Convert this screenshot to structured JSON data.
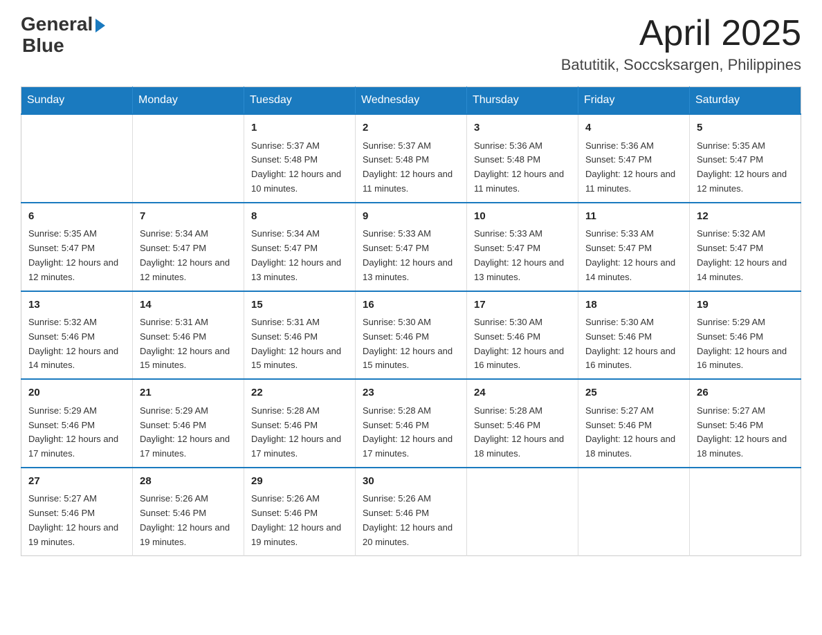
{
  "logo": {
    "text_general": "General",
    "text_blue": "Blue",
    "arrow": "▶"
  },
  "header": {
    "month_year": "April 2025",
    "location": "Batutitik, Soccsksargen, Philippines"
  },
  "weekdays": [
    "Sunday",
    "Monday",
    "Tuesday",
    "Wednesday",
    "Thursday",
    "Friday",
    "Saturday"
  ],
  "weeks": [
    [
      {
        "day": "",
        "sunrise": "",
        "sunset": "",
        "daylight": ""
      },
      {
        "day": "",
        "sunrise": "",
        "sunset": "",
        "daylight": ""
      },
      {
        "day": "1",
        "sunrise": "Sunrise: 5:37 AM",
        "sunset": "Sunset: 5:48 PM",
        "daylight": "Daylight: 12 hours and 10 minutes."
      },
      {
        "day": "2",
        "sunrise": "Sunrise: 5:37 AM",
        "sunset": "Sunset: 5:48 PM",
        "daylight": "Daylight: 12 hours and 11 minutes."
      },
      {
        "day": "3",
        "sunrise": "Sunrise: 5:36 AM",
        "sunset": "Sunset: 5:48 PM",
        "daylight": "Daylight: 12 hours and 11 minutes."
      },
      {
        "day": "4",
        "sunrise": "Sunrise: 5:36 AM",
        "sunset": "Sunset: 5:47 PM",
        "daylight": "Daylight: 12 hours and 11 minutes."
      },
      {
        "day": "5",
        "sunrise": "Sunrise: 5:35 AM",
        "sunset": "Sunset: 5:47 PM",
        "daylight": "Daylight: 12 hours and 12 minutes."
      }
    ],
    [
      {
        "day": "6",
        "sunrise": "Sunrise: 5:35 AM",
        "sunset": "Sunset: 5:47 PM",
        "daylight": "Daylight: 12 hours and 12 minutes."
      },
      {
        "day": "7",
        "sunrise": "Sunrise: 5:34 AM",
        "sunset": "Sunset: 5:47 PM",
        "daylight": "Daylight: 12 hours and 12 minutes."
      },
      {
        "day": "8",
        "sunrise": "Sunrise: 5:34 AM",
        "sunset": "Sunset: 5:47 PM",
        "daylight": "Daylight: 12 hours and 13 minutes."
      },
      {
        "day": "9",
        "sunrise": "Sunrise: 5:33 AM",
        "sunset": "Sunset: 5:47 PM",
        "daylight": "Daylight: 12 hours and 13 minutes."
      },
      {
        "day": "10",
        "sunrise": "Sunrise: 5:33 AM",
        "sunset": "Sunset: 5:47 PM",
        "daylight": "Daylight: 12 hours and 13 minutes."
      },
      {
        "day": "11",
        "sunrise": "Sunrise: 5:33 AM",
        "sunset": "Sunset: 5:47 PM",
        "daylight": "Daylight: 12 hours and 14 minutes."
      },
      {
        "day": "12",
        "sunrise": "Sunrise: 5:32 AM",
        "sunset": "Sunset: 5:47 PM",
        "daylight": "Daylight: 12 hours and 14 minutes."
      }
    ],
    [
      {
        "day": "13",
        "sunrise": "Sunrise: 5:32 AM",
        "sunset": "Sunset: 5:46 PM",
        "daylight": "Daylight: 12 hours and 14 minutes."
      },
      {
        "day": "14",
        "sunrise": "Sunrise: 5:31 AM",
        "sunset": "Sunset: 5:46 PM",
        "daylight": "Daylight: 12 hours and 15 minutes."
      },
      {
        "day": "15",
        "sunrise": "Sunrise: 5:31 AM",
        "sunset": "Sunset: 5:46 PM",
        "daylight": "Daylight: 12 hours and 15 minutes."
      },
      {
        "day": "16",
        "sunrise": "Sunrise: 5:30 AM",
        "sunset": "Sunset: 5:46 PM",
        "daylight": "Daylight: 12 hours and 15 minutes."
      },
      {
        "day": "17",
        "sunrise": "Sunrise: 5:30 AM",
        "sunset": "Sunset: 5:46 PM",
        "daylight": "Daylight: 12 hours and 16 minutes."
      },
      {
        "day": "18",
        "sunrise": "Sunrise: 5:30 AM",
        "sunset": "Sunset: 5:46 PM",
        "daylight": "Daylight: 12 hours and 16 minutes."
      },
      {
        "day": "19",
        "sunrise": "Sunrise: 5:29 AM",
        "sunset": "Sunset: 5:46 PM",
        "daylight": "Daylight: 12 hours and 16 minutes."
      }
    ],
    [
      {
        "day": "20",
        "sunrise": "Sunrise: 5:29 AM",
        "sunset": "Sunset: 5:46 PM",
        "daylight": "Daylight: 12 hours and 17 minutes."
      },
      {
        "day": "21",
        "sunrise": "Sunrise: 5:29 AM",
        "sunset": "Sunset: 5:46 PM",
        "daylight": "Daylight: 12 hours and 17 minutes."
      },
      {
        "day": "22",
        "sunrise": "Sunrise: 5:28 AM",
        "sunset": "Sunset: 5:46 PM",
        "daylight": "Daylight: 12 hours and 17 minutes."
      },
      {
        "day": "23",
        "sunrise": "Sunrise: 5:28 AM",
        "sunset": "Sunset: 5:46 PM",
        "daylight": "Daylight: 12 hours and 17 minutes."
      },
      {
        "day": "24",
        "sunrise": "Sunrise: 5:28 AM",
        "sunset": "Sunset: 5:46 PM",
        "daylight": "Daylight: 12 hours and 18 minutes."
      },
      {
        "day": "25",
        "sunrise": "Sunrise: 5:27 AM",
        "sunset": "Sunset: 5:46 PM",
        "daylight": "Daylight: 12 hours and 18 minutes."
      },
      {
        "day": "26",
        "sunrise": "Sunrise: 5:27 AM",
        "sunset": "Sunset: 5:46 PM",
        "daylight": "Daylight: 12 hours and 18 minutes."
      }
    ],
    [
      {
        "day": "27",
        "sunrise": "Sunrise: 5:27 AM",
        "sunset": "Sunset: 5:46 PM",
        "daylight": "Daylight: 12 hours and 19 minutes."
      },
      {
        "day": "28",
        "sunrise": "Sunrise: 5:26 AM",
        "sunset": "Sunset: 5:46 PM",
        "daylight": "Daylight: 12 hours and 19 minutes."
      },
      {
        "day": "29",
        "sunrise": "Sunrise: 5:26 AM",
        "sunset": "Sunset: 5:46 PM",
        "daylight": "Daylight: 12 hours and 19 minutes."
      },
      {
        "day": "30",
        "sunrise": "Sunrise: 5:26 AM",
        "sunset": "Sunset: 5:46 PM",
        "daylight": "Daylight: 12 hours and 20 minutes."
      },
      {
        "day": "",
        "sunrise": "",
        "sunset": "",
        "daylight": ""
      },
      {
        "day": "",
        "sunrise": "",
        "sunset": "",
        "daylight": ""
      },
      {
        "day": "",
        "sunrise": "",
        "sunset": "",
        "daylight": ""
      }
    ]
  ]
}
